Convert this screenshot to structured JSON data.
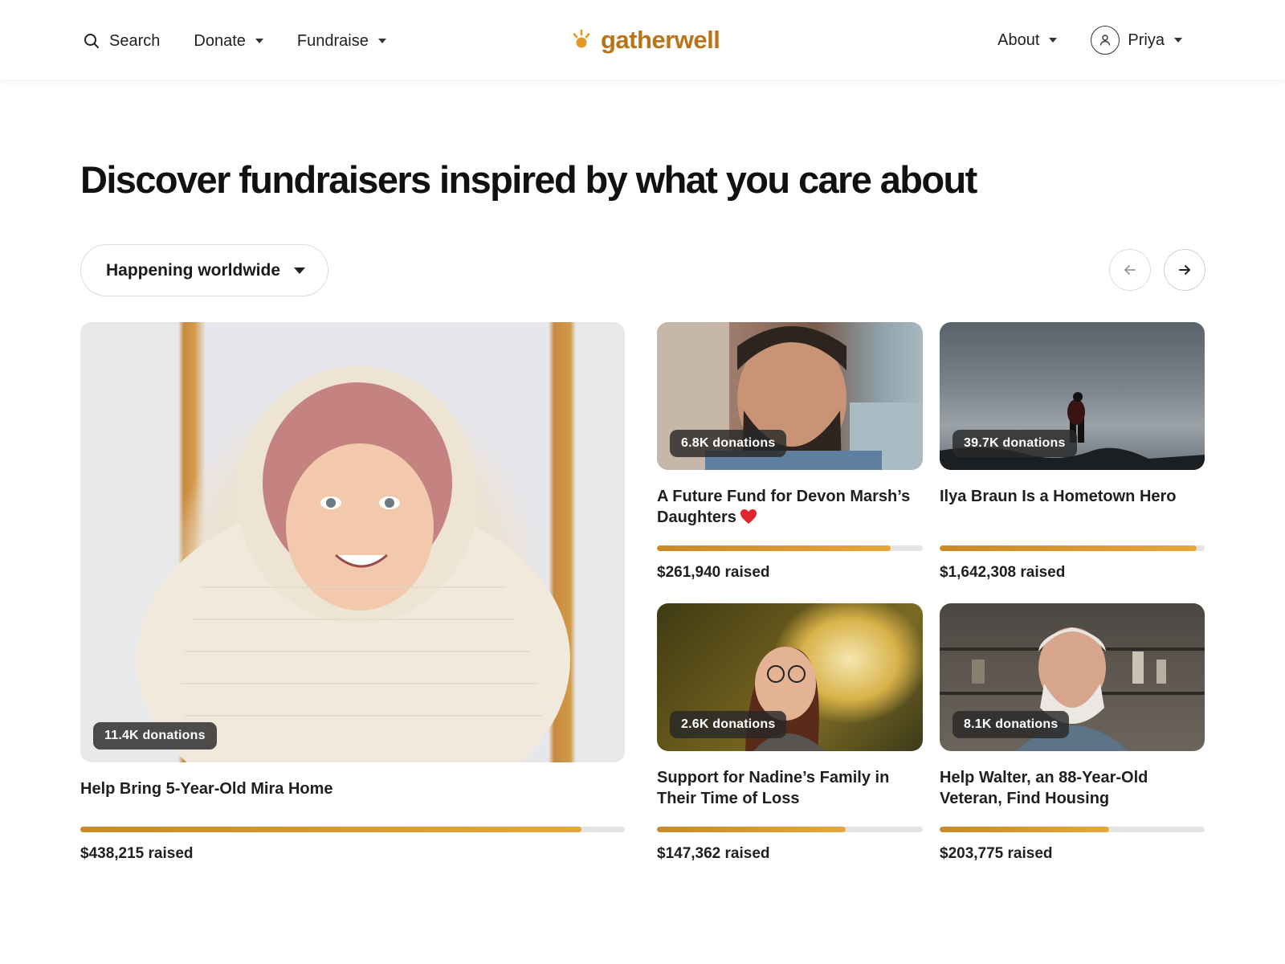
{
  "header": {
    "search_label": "Search",
    "donate_label": "Donate",
    "fundraise_label": "Fundraise",
    "logo_text": "gatherwell",
    "about_label": "About",
    "user_name": "Priya"
  },
  "main": {
    "title": "Discover fundraisers inspired by what you care about",
    "filter_label": "Happening worldwide"
  },
  "fundraisers": [
    {
      "title": "Help Bring 5-Year-Old Mira Home",
      "donations": "11.4K donations",
      "raised": "$438,215 raised",
      "progress": 0.92
    },
    {
      "title": "A Future Fund for Devon Marsh’s Daughters",
      "donations": "6.8K donations",
      "raised": "$261,940 raised",
      "progress": 0.88
    },
    {
      "title": "Ilya Braun Is a Hometown Hero",
      "donations": "39.7K donations",
      "raised": "$1,642,308 raised",
      "progress": 0.97
    },
    {
      "title": "Support for Nadine’s Family in Their Time of Loss",
      "donations": "2.6K donations",
      "raised": "$147,362 raised",
      "progress": 0.71
    },
    {
      "title": "Help Walter, an 88-Year-Old Veteran, Find Housing",
      "donations": "8.1K donations",
      "raised": "$203,775 raised",
      "progress": 0.64
    }
  ],
  "colors": {
    "brand": "#b9741a",
    "progress_fill": "#d8962e",
    "progress_track": "#e4e4e4"
  }
}
